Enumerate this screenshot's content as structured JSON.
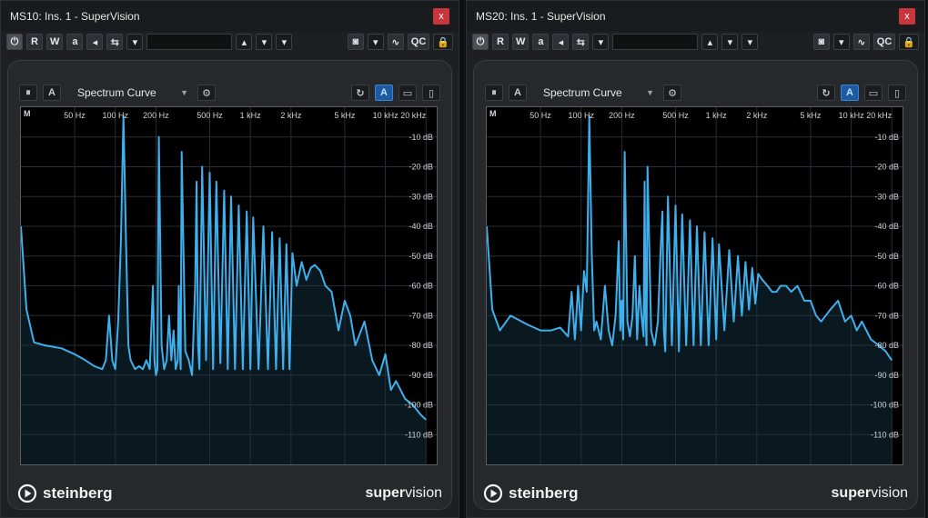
{
  "windows": [
    {
      "id": "left",
      "title": "MS10: Ins. 1 - SuperVision",
      "close_label": "x",
      "toolbar": {
        "read_label": "R",
        "write_label": "W",
        "a_label": "a",
        "qc_label": "QC",
        "preset_value": ""
      },
      "panel": {
        "pause_icon": "pause-icon",
        "a_label": "A",
        "mode": "Spectrum Curve",
        "hold_a_label": "A"
      },
      "plot_corner": "M",
      "freq_ticks": [
        "50 Hz",
        "100 Hz",
        "200 Hz",
        "500 Hz",
        "1 kHz",
        "2 kHz",
        "5 kHz",
        "10 kHz",
        "20 kHz"
      ],
      "db_ticks": [
        "-10 dB",
        "-20 dB",
        "-30 dB",
        "-40 dB",
        "-50 dB",
        "-60 dB",
        "-70 dB",
        "-80 dB",
        "-90 dB",
        "-100 dB",
        "-110 dB"
      ],
      "footer": {
        "brand": "steinberg",
        "product_a": "super",
        "product_b": "vision"
      }
    },
    {
      "id": "right",
      "title": "MS20: Ins. 1 - SuperVision",
      "close_label": "x",
      "toolbar": {
        "read_label": "R",
        "write_label": "W",
        "a_label": "a",
        "qc_label": "QC",
        "preset_value": ""
      },
      "panel": {
        "pause_icon": "pause-icon",
        "a_label": "A",
        "mode": "Spectrum Curve",
        "hold_a_label": "A"
      },
      "plot_corner": "M",
      "freq_ticks": [
        "50 Hz",
        "100 Hz",
        "200 Hz",
        "500 Hz",
        "1 kHz",
        "2 kHz",
        "5 kHz",
        "10 kHz",
        "20 kHz"
      ],
      "db_ticks": [
        "-10 dB",
        "-20 dB",
        "-30 dB",
        "-40 dB",
        "-50 dB",
        "-60 dB",
        "-70 dB",
        "-80 dB",
        "-90 dB",
        "-100 dB",
        "-110 dB"
      ],
      "footer": {
        "brand": "steinberg",
        "product_a": "super",
        "product_b": "vision"
      }
    }
  ],
  "colors": {
    "curve": "#3fb0ec",
    "accent": "#1d5aa0",
    "close": "#c8353b"
  },
  "chart_data": [
    {
      "type": "line",
      "x_scale": "log",
      "xlim": [
        20,
        24000
      ],
      "ylim": [
        -120,
        0
      ],
      "grid": true,
      "series": [
        {
          "x": [
            20,
            22,
            25,
            30,
            40,
            50,
            60,
            70,
            80,
            85,
            90,
            95,
            100,
            105,
            110,
            115,
            120,
            125,
            130,
            140,
            150,
            160,
            170,
            180,
            190,
            195,
            200,
            205,
            210,
            220,
            230,
            240,
            250,
            260,
            270,
            280,
            290,
            295,
            300,
            305,
            310,
            330,
            350,
            370,
            390,
            400,
            410,
            420,
            440,
            470,
            500,
            530,
            560,
            600,
            640,
            680,
            720,
            770,
            820,
            880,
            940,
            1000,
            1050,
            1150,
            1250,
            1350,
            1450,
            1550,
            1650,
            1750,
            1850,
            1950,
            2050,
            2200,
            2400,
            2600,
            2800,
            3000,
            3300,
            3600,
            4000,
            4500,
            5000,
            5500,
            6000,
            7000,
            8000,
            9000,
            10000,
            11000,
            12000,
            14000,
            16000,
            18000,
            20000
          ],
          "y": [
            -40,
            -68,
            -79,
            -80,
            -81,
            -83,
            -85,
            -87,
            -88,
            -85,
            -70,
            -85,
            -88,
            -72,
            -45,
            -3,
            -45,
            -80,
            -85,
            -88,
            -87,
            -88,
            -85,
            -88,
            -60,
            -85,
            -90,
            -88,
            -10,
            -80,
            -88,
            -85,
            -70,
            -85,
            -75,
            -88,
            -85,
            -60,
            -80,
            -88,
            -15,
            -82,
            -85,
            -90,
            -60,
            -25,
            -80,
            -88,
            -20,
            -85,
            -22,
            -88,
            -25,
            -86,
            -28,
            -88,
            -30,
            -88,
            -33,
            -88,
            -35,
            -88,
            -37,
            -88,
            -40,
            -88,
            -42,
            -88,
            -44,
            -88,
            -46,
            -88,
            -49,
            -60,
            -52,
            -58,
            -54,
            -53,
            -55,
            -60,
            -62,
            -75,
            -65,
            -70,
            -80,
            -72,
            -85,
            -90,
            -83,
            -95,
            -92,
            -98,
            -100,
            -103,
            -105
          ]
        }
      ]
    },
    {
      "type": "line",
      "x_scale": "log",
      "xlim": [
        20,
        24000
      ],
      "ylim": [
        -120,
        0
      ],
      "grid": true,
      "series": [
        {
          "x": [
            20,
            22,
            25,
            30,
            40,
            50,
            60,
            70,
            80,
            85,
            90,
            95,
            100,
            105,
            110,
            115,
            120,
            125,
            130,
            140,
            150,
            160,
            170,
            180,
            190,
            195,
            200,
            205,
            210,
            220,
            230,
            240,
            250,
            260,
            270,
            280,
            290,
            295,
            300,
            305,
            310,
            330,
            350,
            370,
            390,
            400,
            410,
            420,
            440,
            470,
            500,
            530,
            560,
            600,
            640,
            680,
            720,
            770,
            820,
            880,
            940,
            1000,
            1050,
            1150,
            1250,
            1350,
            1450,
            1550,
            1650,
            1750,
            1850,
            1950,
            2050,
            2200,
            2400,
            2600,
            2800,
            3000,
            3300,
            3600,
            4000,
            4500,
            5000,
            5500,
            6000,
            7000,
            8000,
            9000,
            10000,
            11000,
            12000,
            14000,
            16000,
            18000,
            20000
          ],
          "y": [
            -40,
            -68,
            -75,
            -70,
            -73,
            -75,
            -75,
            -74,
            -77,
            -62,
            -78,
            -60,
            -75,
            -55,
            -62,
            -3,
            -50,
            -75,
            -72,
            -78,
            -60,
            -75,
            -80,
            -70,
            -45,
            -75,
            -65,
            -78,
            -15,
            -72,
            -77,
            -70,
            -50,
            -78,
            -60,
            -70,
            -77,
            -25,
            -70,
            -80,
            -20,
            -75,
            -80,
            -72,
            -45,
            -35,
            -75,
            -82,
            -30,
            -80,
            -33,
            -82,
            -36,
            -80,
            -38,
            -80,
            -40,
            -80,
            -42,
            -80,
            -44,
            -78,
            -46,
            -75,
            -48,
            -72,
            -50,
            -70,
            -52,
            -68,
            -54,
            -66,
            -56,
            -58,
            -60,
            -62,
            -62,
            -60,
            -60,
            -62,
            -60,
            -65,
            -65,
            -70,
            -72,
            -68,
            -65,
            -72,
            -70,
            -75,
            -72,
            -78,
            -80,
            -82,
            -85
          ]
        }
      ]
    }
  ]
}
